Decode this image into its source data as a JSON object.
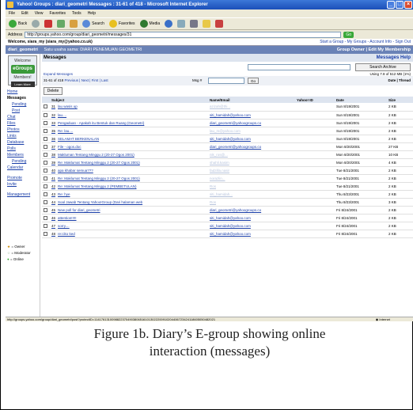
{
  "window": {
    "title": "Yahoo! Groups : diari_geometri Messages : 31-61 of 418 - Microsoft Internet Explorer",
    "controls": [
      "_",
      "□",
      "×"
    ]
  },
  "menu": [
    "File",
    "Edit",
    "View",
    "Favorites",
    "Tools",
    "Help"
  ],
  "toolbar": {
    "back": "Back",
    "search": "Search",
    "favorites": "Favorites",
    "media": "Media"
  },
  "address": {
    "label": "Address",
    "url": "http://groups.yahoo.com/group/diari_geometri/messages/31",
    "go": "Go"
  },
  "welcome": {
    "text": "Welcome, siara_my (siara_my@yahoo.co.uk)",
    "links": "Start a Group - My Groups - Account Info - Sign Out"
  },
  "group": {
    "name": "diari_geometri",
    "tagline": "Satu usaha sama: DIARI PENEMUAN GEOMETRI",
    "owner": "Group Owner | Edit My Membership"
  },
  "sidebar": {
    "welcome": "Welcome",
    "logo": "eGroups",
    "members": "Members!",
    "learn": "Learn More",
    "nav": [
      {
        "label": "Home",
        "cls": ""
      },
      {
        "label": "Messages",
        "cls": "active"
      },
      {
        "label": "Pending",
        "cls": "sub"
      },
      {
        "label": "Post",
        "cls": "sub"
      },
      {
        "label": "Chat",
        "cls": ""
      },
      {
        "label": "Files",
        "cls": ""
      },
      {
        "label": "Photos",
        "cls": ""
      },
      {
        "label": "Links",
        "cls": ""
      },
      {
        "label": "Database",
        "cls": ""
      },
      {
        "label": "Polls",
        "cls": ""
      },
      {
        "label": "Members",
        "cls": ""
      },
      {
        "label": "Pending",
        "cls": "sub"
      },
      {
        "label": "Calendar",
        "cls": ""
      },
      {
        "label": "Promote",
        "cls": "gap"
      },
      {
        "label": "Invite",
        "cls": ""
      },
      {
        "label": "Management",
        "cls": "gap"
      }
    ],
    "legend": [
      "= Owner",
      "= Moderator",
      "= Online"
    ]
  },
  "messages": {
    "title": "Messages",
    "help": "Messages Help",
    "search_button": "Search Archive",
    "expand": "Expand Messages",
    "usage": "Using 7.8 of 512 MB (1%)",
    "pager_range": "31-61 of 418",
    "pager_links": "Previous | Next | First | Last",
    "msg_label": "Msg #",
    "go": "Go",
    "sort": "Date | Thread",
    "delete": "Delete",
    "columns": [
      "",
      "Subject",
      "Name/Email",
      "Yahoo! ID",
      "Date",
      "Size"
    ],
    "rows": [
      {
        "n": "31",
        "subject": "lau wasis up",
        "email": "azizah@thi...",
        "faded": true,
        "date": "Sun 8/19/2001",
        "size": "2 KB"
      },
      {
        "n": "32",
        "subject": "lau....",
        "email": "siti_hamidah@yahoo.com",
        "faded": false,
        "date": "Sun 8/19/2001",
        "size": "2 KB"
      },
      {
        "n": "33",
        "subject": "Pengaduan - Apakah itu Bentuk dan Ruang (Geometri)",
        "email": "diari_geometri@yahoogroups.co",
        "faded": false,
        "date": "Sun 8/19/2001",
        "size": "2 KB"
      },
      {
        "n": "35",
        "subject": "Re: lau....",
        "email": "lau_m@yahoo.com",
        "faded": true,
        "date": "Sun 8/19/2001",
        "size": "2 KB"
      },
      {
        "n": "36",
        "subject": "SELAMAT BERKENALAN",
        "email": "siti_hamidah@yahoo.com",
        "faded": false,
        "date": "Sun 8/19/2001",
        "size": "2 KB"
      },
      {
        "n": "37",
        "subject": "File - ogos.doc",
        "email": "diari_geometri@yahoogroups.co",
        "faded": false,
        "date": "Mon 8/20/2001",
        "size": "27 KB"
      },
      {
        "n": "38",
        "subject": "Makluman Tentang Minggu 2 (20-27 Ogos 2001)",
        "email": "nik_ros@...",
        "faded": true,
        "date": "Mon 8/20/2001",
        "size": "10 KB"
      },
      {
        "n": "39",
        "subject": "Re: Maklumat Tentang Minggu 2 (20-27 Ogos 2001)",
        "email": "shahli.kasim",
        "faded": true,
        "date": "Mon 8/20/2001",
        "size": "4 KB"
      },
      {
        "n": "40",
        "subject": "apa khabar semua???",
        "email": "fadzilla.nasir",
        "faded": true,
        "date": "Tue 8/21/2001",
        "size": "2 KB"
      },
      {
        "n": "41",
        "subject": "Re: Maklumat Tentang Minggu 2 (20-27 Ogos 2001)",
        "email": "norazlin...",
        "faded": true,
        "date": "Tue 8/21/2001",
        "size": "2 KB"
      },
      {
        "n": "42",
        "subject": "Re: Maklumat Tentang Minggu 2 (PEMBETULAN)",
        "email": "Ros",
        "faded": true,
        "date": "Tue 8/21/2001",
        "size": "2 KB"
      },
      {
        "n": "43",
        "subject": "Re: hye",
        "email": "siti_hamidah...",
        "faded": true,
        "date": "Thu 8/23/2001",
        "size": "2 KB"
      },
      {
        "n": "44",
        "subject": "Soal Jawab Tentang Yahoo!Group (Dari halaman web",
        "email": "Ros",
        "faded": true,
        "date": "Thu 8/23/2001",
        "size": "3 KB"
      },
      {
        "n": "45",
        "subject": "New poll for diari_geometri",
        "email": "diari_geometri@yahoogroups.co",
        "faded": false,
        "date": "Fri 8/24/2001",
        "size": "2 KB"
      },
      {
        "n": "46",
        "subject": "attention!!!!!",
        "email": "siti_hamidah@yahoo.com",
        "faded": false,
        "date": "Fri 8/24/2001",
        "size": "2 KB"
      },
      {
        "n": "47",
        "subject": "sorry....",
        "email": "siti_hamidah@yahoo.com",
        "faded": false,
        "date": "Fri 8/24/2001",
        "size": "2 KB"
      },
      {
        "n": "48",
        "subject": "re:ciko ked",
        "email": "siti_hamidah@yahoo.com",
        "faded": false,
        "date": "Fri 8/24/2001",
        "size": "2 KB"
      }
    ]
  },
  "status": {
    "url": "http://groups.yahoo.com/group/diari_geometri/post?protectID=114176131009882237049038065161013022200910204406723424118605050482021",
    "zone": "Internet"
  },
  "caption": {
    "line1": "Figure 1b. Diary’s E-group showing online",
    "line2": "interaction (messages)"
  }
}
